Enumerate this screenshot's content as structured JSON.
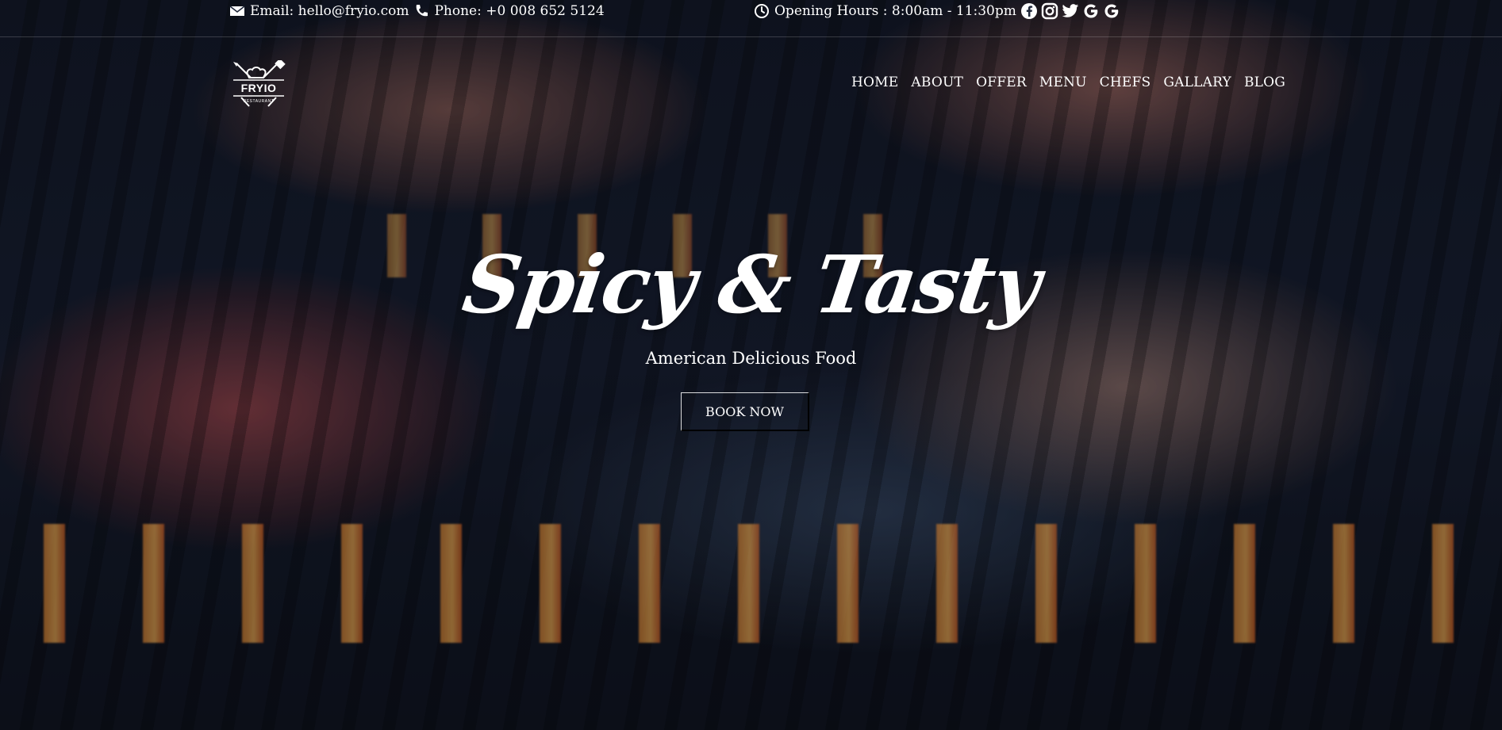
{
  "topbar": {
    "email_text": "Email: hello@fryio.com",
    "phone_text": "Phone: +0 008 652 5124",
    "hours_text": "Opening Hours : 8:00am - 11:30pm",
    "social": [
      "facebook-icon",
      "instagram-icon",
      "twitter-icon",
      "google-icon",
      "google-icon"
    ]
  },
  "logo": {
    "brand": "FRYIO",
    "tagline": "RESTAURANT"
  },
  "nav": {
    "items": [
      "HOME",
      "ABOUT",
      "OFFER",
      "MENU",
      "CHEFS",
      "GALLARY",
      "BLOG"
    ]
  },
  "hero": {
    "title": "Spicy & Tasty",
    "subtitle": "American Delicious Food",
    "cta": "BOOK NOW"
  },
  "colors": {
    "text": "#ffffff",
    "overlay": "#0a0c14"
  }
}
